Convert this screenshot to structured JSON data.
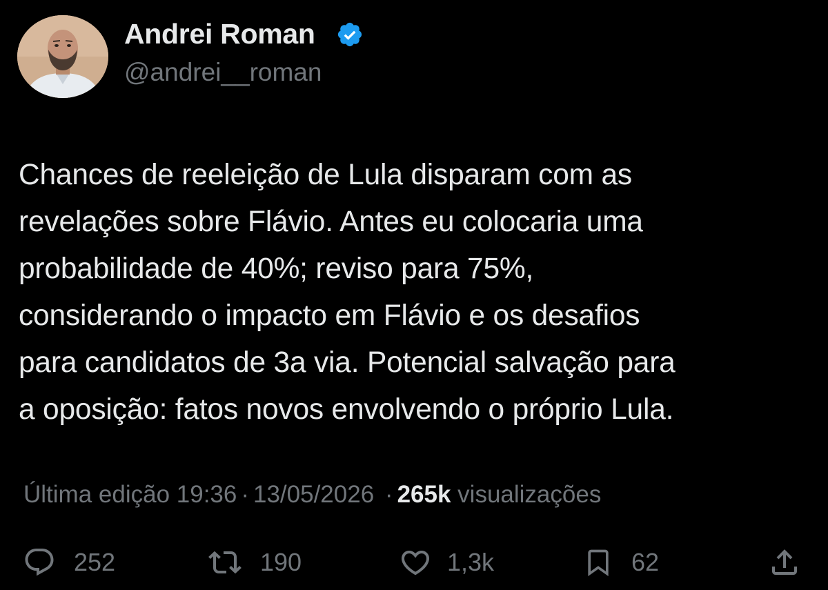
{
  "author": {
    "display_name": "Andrei Roman",
    "handle": "@andrei__roman",
    "verified": true,
    "verified_color": "#1d9bf0",
    "avatar_icon": "profile-photo"
  },
  "tweet": {
    "text": "Chances de reeleição de Lula disparam com as\nrevelações sobre Flávio. Antes eu colocaria uma\nprobabilidade de 40%; reviso para 75%,\nconsiderando o impacto em Flávio e os desafios\npara candidatos de 3a via. Potencial salvação para\na oposição: fatos novos envolvendo o próprio Lula."
  },
  "meta": {
    "edited_label": "Última edição 19:36",
    "separator": "·",
    "date": "13/05/2026",
    "views_count": "265k",
    "views_label": "visualizações"
  },
  "actions": {
    "reply": {
      "icon": "reply-icon",
      "count": "252"
    },
    "retweet": {
      "icon": "retweet-icon",
      "count": "190"
    },
    "like": {
      "icon": "heart-icon",
      "count": "1,3k"
    },
    "bookmark": {
      "icon": "bookmark-icon",
      "count": "62"
    },
    "share": {
      "icon": "share-icon"
    }
  },
  "colors": {
    "background": "#000000",
    "primary_text": "#e7e9ea",
    "secondary_text": "#71767b",
    "accent": "#1d9bf0"
  }
}
